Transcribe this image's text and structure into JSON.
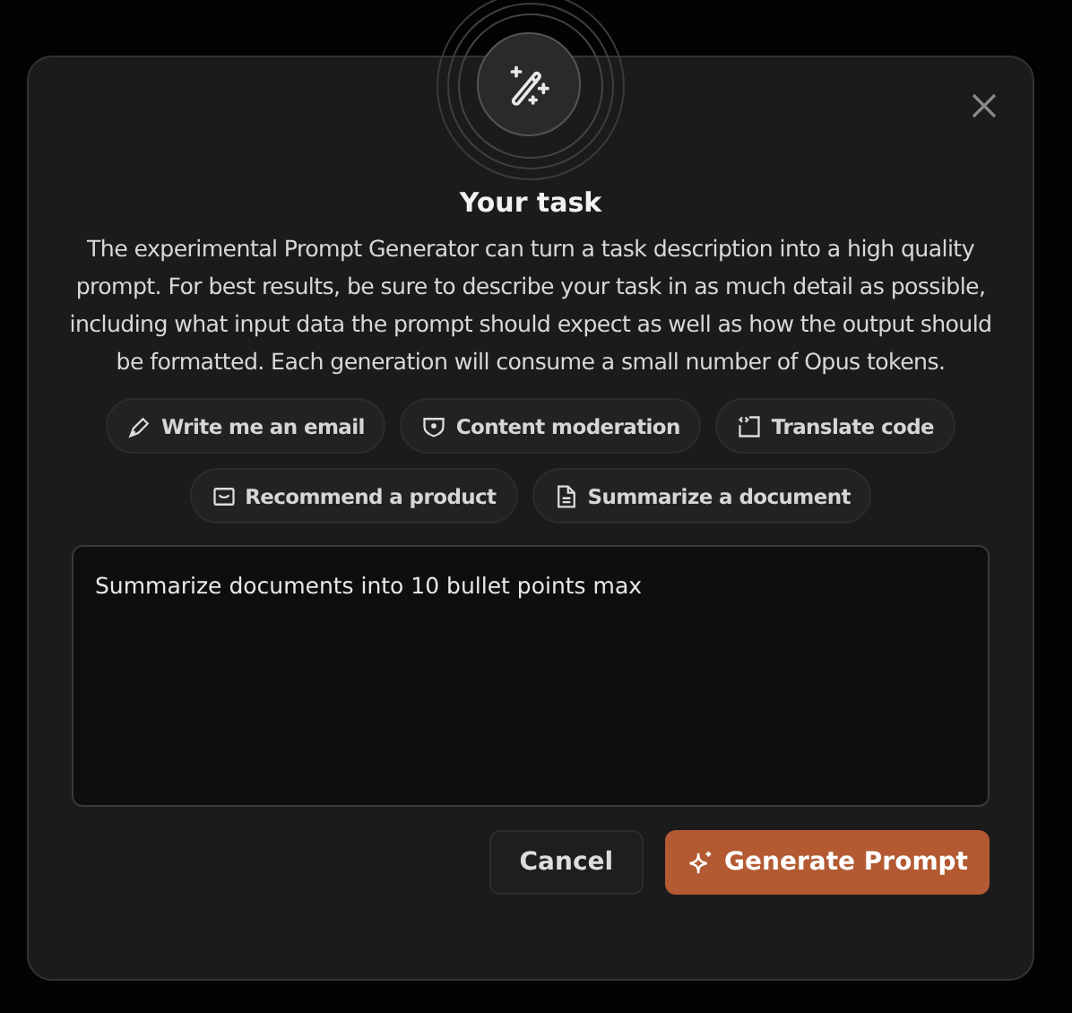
{
  "dialog": {
    "title": "Your task",
    "description": "The experimental Prompt Generator can turn a task description into a high quality prompt. For best results, be sure to describe your task in as much detail as possible, including what input data the prompt should expect as well as how the output should be formatted. Each generation will consume a small number of Opus tokens."
  },
  "suggestions": [
    {
      "label": "Write me an email",
      "kind": "pen"
    },
    {
      "label": "Content moderation",
      "kind": "shield"
    },
    {
      "label": "Translate code",
      "kind": "code"
    },
    {
      "label": "Recommend a product",
      "kind": "box"
    },
    {
      "label": "Summarize a document",
      "kind": "doc"
    }
  ],
  "task_field": {
    "value": "Summarize documents into 10 bullet points max"
  },
  "buttons": {
    "cancel": "Cancel",
    "generate": "Generate Prompt"
  }
}
